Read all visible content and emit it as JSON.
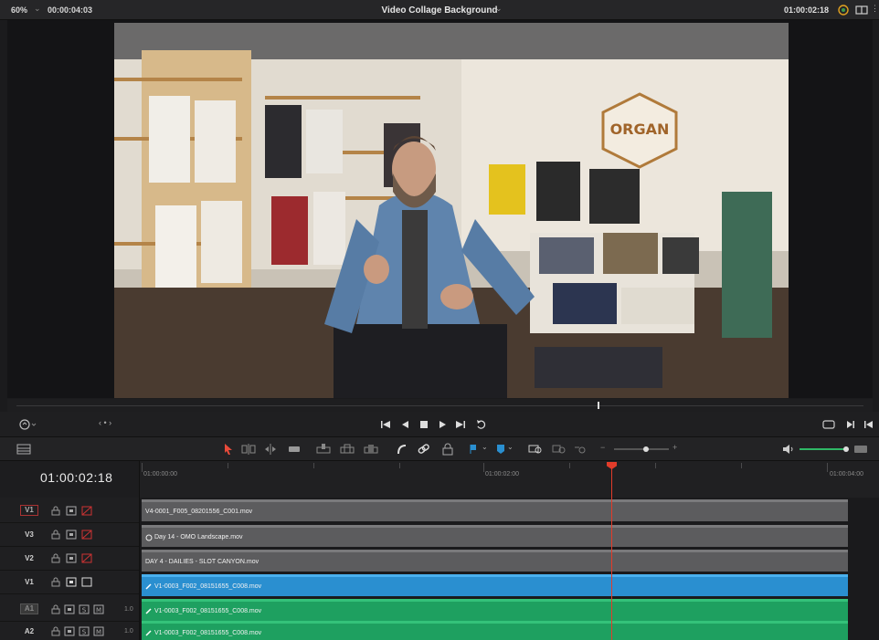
{
  "viewer": {
    "zoom": "60%",
    "source_timecode": "00:00:04:03",
    "timeline_title": "Video Collage Background",
    "record_timecode": "01:00:02:18"
  },
  "timeline": {
    "current_timecode": "01:00:02:18",
    "ruler_labels": [
      "01:00:00:00",
      "01:00:02:00",
      "01:00:04:00"
    ],
    "nav_label": "‹ • ›"
  },
  "tracks": [
    {
      "name": "V1",
      "kind": "video-dest",
      "clip": "V4-0001_F005_08201556_C001.mov",
      "color": "gray"
    },
    {
      "name": "V3",
      "kind": "video",
      "clip": "Day 14 - OMO Landscape.mov",
      "color": "gray"
    },
    {
      "name": "V2",
      "kind": "video",
      "clip": "DAY 4 - DAILIES - SLOT CANYON.mov",
      "color": "gray"
    },
    {
      "name": "V1",
      "kind": "video",
      "clip": "V1-0003_F002_08151655_C008.mov",
      "color": "blue"
    },
    {
      "name": "A1",
      "kind": "audio",
      "volume": "1.0",
      "clip": "V1-0003_F002_08151655_C008.mov",
      "color": "green"
    },
    {
      "name": "A2",
      "kind": "audio",
      "volume": "1.0",
      "clip": "V1-0003_F002_08151655_C008.mov",
      "color": "green"
    }
  ],
  "colors": {
    "playhead": "#e23c2a",
    "video_clip": "#5c5c5e",
    "selected_clip": "#2a8fd0",
    "audio_clip": "#1ea060"
  },
  "icons": {
    "transport": [
      "jump-start-icon",
      "reverse-icon",
      "stop-icon",
      "play-icon",
      "jump-end-icon",
      "loop-icon"
    ],
    "tools": [
      "selection-icon",
      "trim-icon",
      "dynamic-trim-icon",
      "blade-icon",
      "insert-icon",
      "overwrite-icon",
      "replace-icon",
      "snap-icon",
      "link-icon",
      "lock-icon",
      "flag-icon",
      "marker-icon",
      "zoom-full-icon",
      "zoom-detail-icon",
      "zoom-custom-icon",
      "speaker-icon"
    ]
  },
  "artwork": {
    "store_logo_text": "ORGAN"
  }
}
